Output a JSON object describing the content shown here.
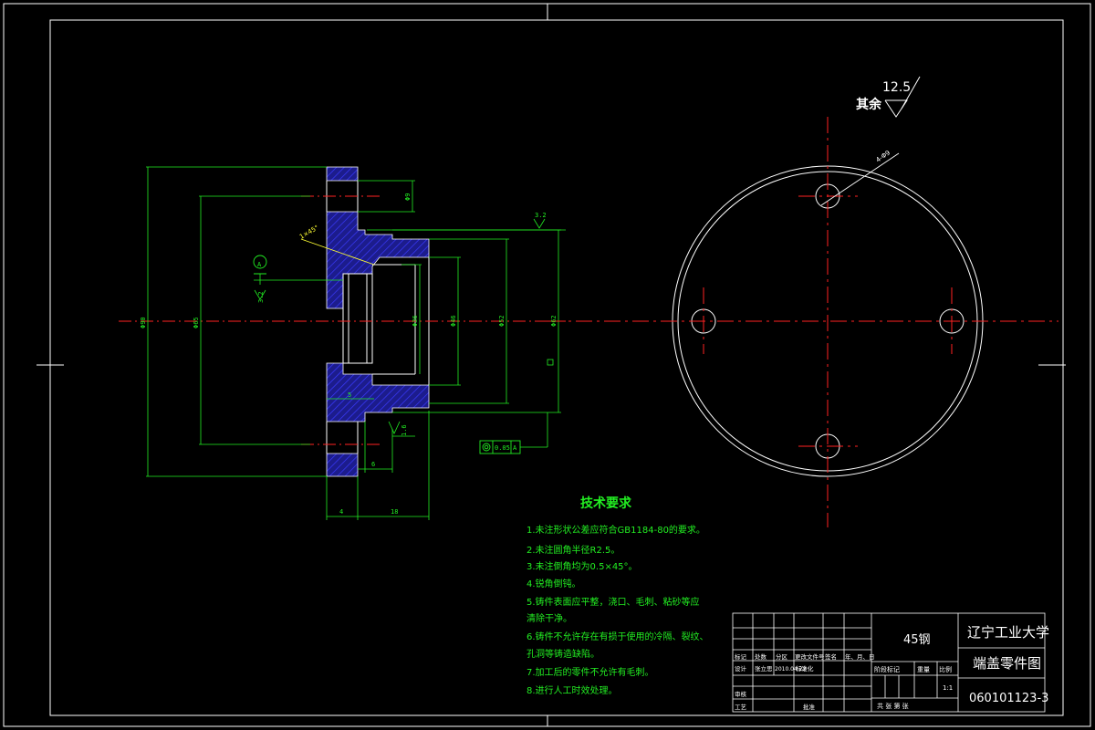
{
  "roughness": {
    "value": "12.5",
    "label": "其余"
  },
  "tech_requirements": {
    "title": "技术要求",
    "items": [
      "1.未注形状公差应符合GB1184-80的要求。",
      "2.未注圆角半径R2.5。",
      "3.未注倒角均为0.5×45°。",
      "4.锐角倒钝。",
      "5.铸件表面应平整，浇口、毛刺、粘砂等应",
      "清除干净。",
      "6.铸件不允许存在有损于使用的冷隔、裂纹、",
      "孔洞等铸造缺陷。",
      "7.加工后的零件不允许有毛刺。",
      "8.进行人工时效处理。"
    ]
  },
  "title_block": {
    "material": "45钢",
    "school": "辽宁工业大学",
    "part_name": "端盖零件图",
    "drawing_number": "060101123-3",
    "scale": "1:1",
    "sheet_text": "共  张  第  张",
    "stage_labels": [
      "阶段标记",
      "重量",
      "比例"
    ],
    "row_labels": {
      "mark": "标记",
      "count": "处数",
      "zone": "分区",
      "doc": "更改文件号",
      "sign_date": "签名",
      "ymd": "年、月、日",
      "design": "设计",
      "designer": "张立思",
      "date": "2010.04.22",
      "standard": "标准化",
      "review": "审核",
      "process": "工艺",
      "approve": "批准"
    }
  },
  "dims": {
    "d_outer": "Φ90",
    "d_bolt": "Φ65",
    "d_bore_small": "Φ36",
    "d_bore": "Φ46",
    "d_step": "Φ52",
    "d_spigot": "Φ62",
    "hole": "Φ9",
    "hole_lead": "4-Φ9",
    "len_5": "5",
    "len_6": "6",
    "len_4": "4",
    "len_18": "18",
    "rough_a": "3.2",
    "rough_b": "3.2",
    "rough_c": "1.6",
    "tolerance": "0.05",
    "datum": "A",
    "chamfer": "1×45°"
  }
}
